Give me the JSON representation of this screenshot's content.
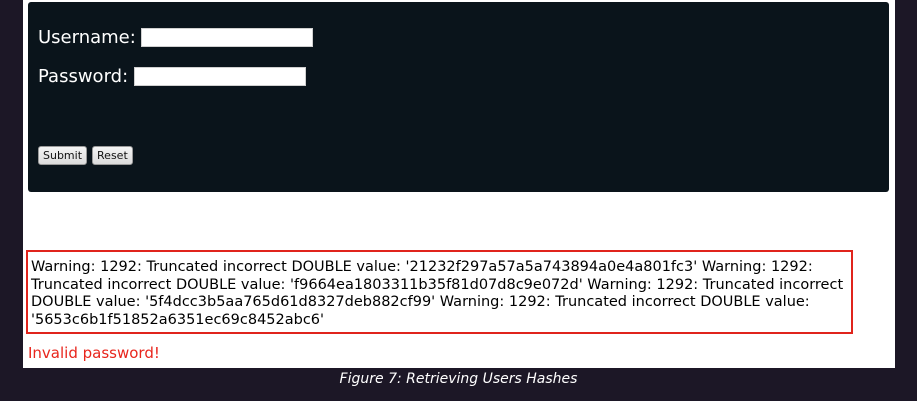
{
  "form": {
    "username_label": "Username:",
    "username_value": "",
    "password_label": "Password:",
    "password_value": "",
    "submit_label": "Submit",
    "reset_label": "Reset"
  },
  "result": {
    "warning_text": "Warning: 1292: Truncated incorrect DOUBLE value: '21232f297a57a5a743894a0e4a801fc3' Warning: 1292: Truncated incorrect DOUBLE value: 'f9664ea1803311b35f81d07d8c9e072d' Warning: 1292: Truncated incorrect DOUBLE value: '5f4dcc3b5aa765d61d8327deb882cf99' Warning: 1292: Truncated incorrect DOUBLE value: '5653c6b1f51852a6351ec69c8452abc6'",
    "error_text": "Invalid password!"
  },
  "caption": "Figure 7: Retrieving Users Hashes",
  "colors": {
    "panel": "#0a141b",
    "error": "#e8251c",
    "warning_border": "#e0241c",
    "page_background": "#1c1726"
  }
}
